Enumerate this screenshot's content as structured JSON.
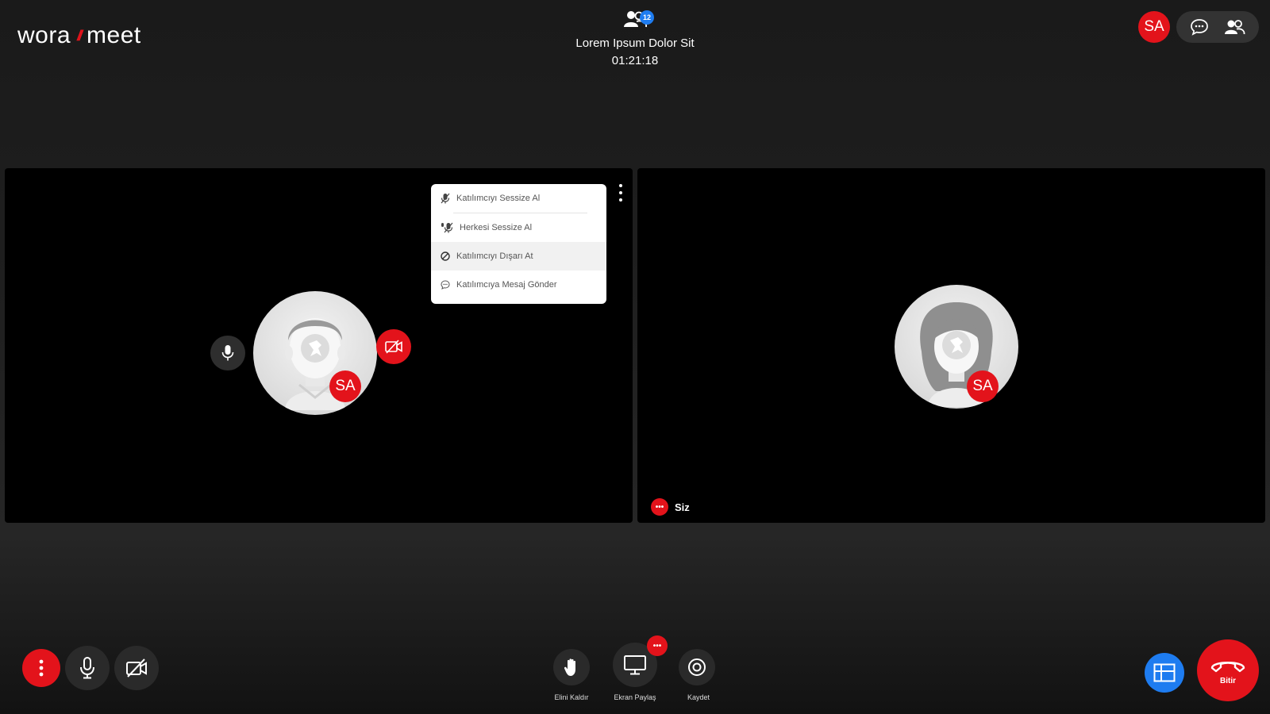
{
  "app": {
    "logo_left": "wora",
    "logo_slash": "//",
    "logo_right": "meet"
  },
  "meeting": {
    "participant_count": "12",
    "title": "Lorem Ipsum Dolor Sit",
    "elapsed": "01:21:18"
  },
  "header": {
    "user_initials": "SA"
  },
  "tiles": {
    "left": {
      "initials": "SA"
    },
    "right": {
      "initials": "SA",
      "name": "Siz",
      "more": "•••"
    }
  },
  "participant_menu": {
    "items": [
      {
        "label": "Katılımcıyı Sessize Al",
        "icon": "mic-off-icon"
      },
      {
        "label": "Herkesi Sessize Al",
        "icon": "mic-off-all-icon"
      },
      {
        "label": "Katılımcıyı Dışarı At",
        "icon": "ban-icon"
      },
      {
        "label": "Katılımcıya Mesaj Gönder",
        "icon": "chat-icon"
      }
    ]
  },
  "toolbar": {
    "raise_hand": "Elini Kaldır",
    "share_screen": "Ekran Paylaş",
    "share_badge": "•••",
    "record": "Kaydet",
    "end": "Bitir"
  },
  "colors": {
    "accent_red": "#e3131b",
    "accent_blue": "#1e7cf0",
    "background": "#1f1f1f",
    "tile": "#000000"
  }
}
